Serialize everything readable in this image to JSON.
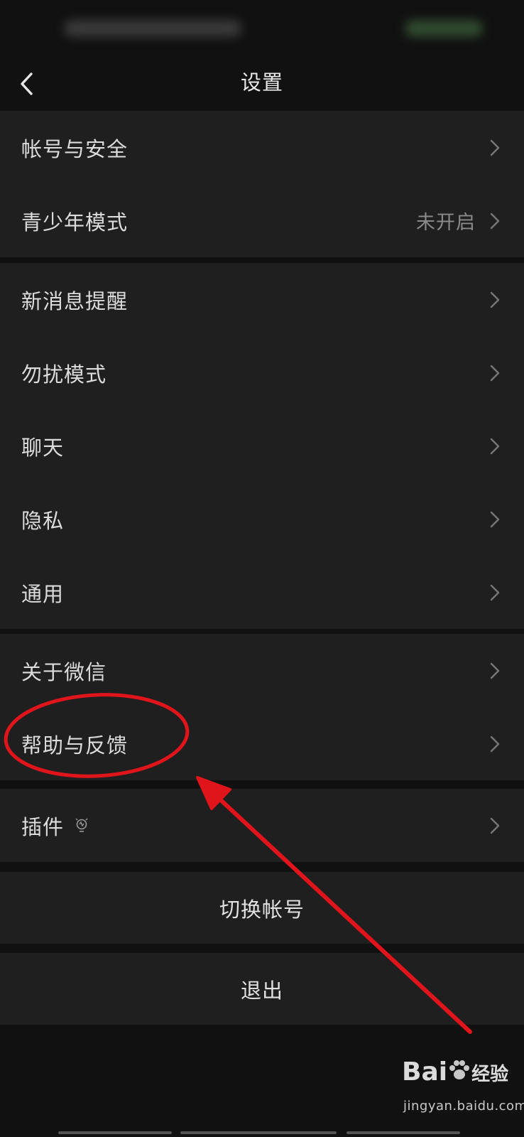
{
  "nav": {
    "title": "设置"
  },
  "groups": [
    {
      "items": [
        {
          "label": "帐号与安全",
          "value": ""
        },
        {
          "label": "青少年模式",
          "value": "未开启"
        }
      ]
    },
    {
      "items": [
        {
          "label": "新消息提醒",
          "value": ""
        },
        {
          "label": "勿扰模式",
          "value": ""
        },
        {
          "label": "聊天",
          "value": ""
        },
        {
          "label": "隐私",
          "value": ""
        },
        {
          "label": "通用",
          "value": ""
        }
      ]
    },
    {
      "items": [
        {
          "label": "关于微信",
          "value": ""
        },
        {
          "label": "帮助与反馈",
          "value": ""
        }
      ]
    },
    {
      "items": [
        {
          "label": "插件",
          "value": "",
          "icon": "lightbulb-icon"
        }
      ]
    }
  ],
  "actions": {
    "switch_account": "切换帐号",
    "logout": "退出"
  },
  "watermark": {
    "logo_prefix": "Bai",
    "logo_suffix": "经验",
    "url": "jingyan.baidu.com"
  },
  "colors": {
    "background": "#111111",
    "row_background": "#1f1f1f",
    "text": "#dcdcdc",
    "secondary_text": "#8a8a8a",
    "annotation": "#e0141b"
  }
}
